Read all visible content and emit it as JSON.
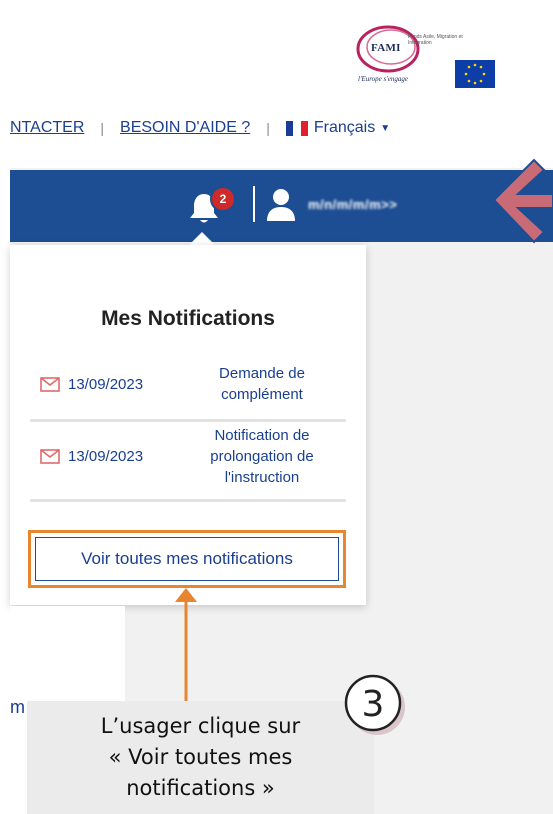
{
  "header": {
    "logo": {
      "name": "FAMI",
      "subtitle": "Fonds Asile, Migration et Intégration",
      "tagline": "l'Europe s'engage",
      "flag": "eu-flag-icon"
    },
    "links": {
      "contact": "NTACTER",
      "help": "BESOIN D'AIDE ?",
      "separator": "|",
      "language": "Français",
      "language_flag": "french-flag-icon"
    }
  },
  "navbar": {
    "notification_count": "2",
    "username": "m/n/m/m/m>>",
    "icons": [
      "bell-icon",
      "user-icon"
    ],
    "color": "#1d4d92"
  },
  "notifications": {
    "title": "Mes Notifications",
    "items": [
      {
        "date": "13/09/2023",
        "lines": [
          "Demande de",
          "complément"
        ]
      },
      {
        "date": "13/09/2023",
        "lines": [
          "Notification de",
          "prolongation de",
          "l'instruction"
        ]
      }
    ],
    "see_all": "Voir toutes mes notifications"
  },
  "tutorial": {
    "step": "3",
    "text_lines": [
      "L’usager clique sur",
      "« Voir toutes mes",
      "notifications »"
    ],
    "highlight_color": "#e8862f",
    "arrow_color": "#c96b76"
  },
  "background": {
    "cut_text": "m"
  }
}
